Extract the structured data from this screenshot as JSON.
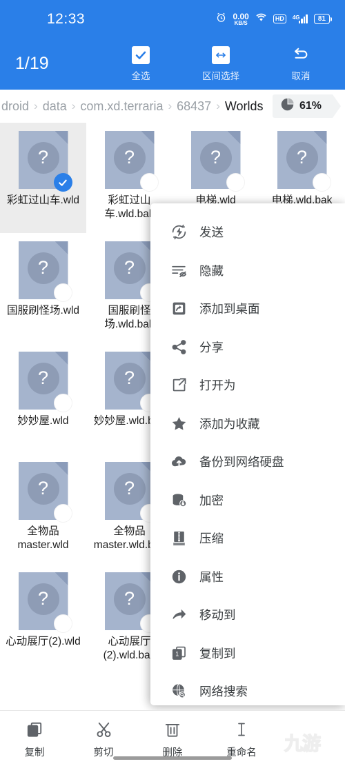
{
  "status_bar": {
    "time": "12:33",
    "alarm_icon": "alarm-icon",
    "net_speed_value": "0.00",
    "net_speed_unit": "KB/S",
    "wifi_icon": "wifi-icon",
    "hd_label": "HD",
    "network_type": "4G",
    "signal_icon": "signal-bars-icon",
    "battery_level": "81"
  },
  "selection_toolbar": {
    "count": "1/19",
    "actions": [
      {
        "label": "全选",
        "icon": "checkbox-checked-icon"
      },
      {
        "label": "区间选择",
        "icon": "arrows-horizontal-icon"
      },
      {
        "label": "取消",
        "icon": "undo-icon"
      }
    ]
  },
  "breadcrumb": {
    "items": [
      "droid",
      "data",
      "com.xd.terraria",
      "68437",
      "Worlds"
    ],
    "separator": "›",
    "storage": {
      "icon": "pie-chart-icon",
      "percent": "61%"
    }
  },
  "files": [
    {
      "name": "彩虹过山车.wld",
      "selected": true,
      "icon": "unknown-file-icon"
    },
    {
      "name": "彩虹过山车.wld.bak",
      "selected": false,
      "icon": "unknown-file-icon"
    },
    {
      "name": "电梯.wld",
      "selected": false,
      "icon": "unknown-file-icon"
    },
    {
      "name": "电梯.wld.bak",
      "selected": false,
      "icon": "unknown-file-icon"
    },
    {
      "name": "国服刷怪场.wld",
      "selected": false,
      "icon": "unknown-file-icon"
    },
    {
      "name": "国服刷怪场.wld.bak",
      "selected": false,
      "icon": "unknown-file-icon"
    },
    {
      "name": "",
      "selected": false,
      "icon": "unknown-file-icon"
    },
    {
      "name": "",
      "selected": false,
      "icon": "unknown-file-icon"
    },
    {
      "name": "妙妙屋.wld",
      "selected": false,
      "icon": "unknown-file-icon"
    },
    {
      "name": "妙妙屋.wld.bak",
      "selected": false,
      "icon": "unknown-file-icon"
    },
    {
      "name": "",
      "selected": false,
      "icon": "unknown-file-icon"
    },
    {
      "name": "",
      "selected": false,
      "icon": "unknown-file-icon"
    },
    {
      "name": "全物品master.wld",
      "selected": false,
      "icon": "unknown-file-icon"
    },
    {
      "name": "全物品master.wld.bak",
      "selected": false,
      "icon": "unknown-file-icon"
    },
    {
      "name": "",
      "selected": false,
      "icon": "unknown-file-icon"
    },
    {
      "name": "",
      "selected": false,
      "icon": "unknown-file-icon"
    },
    {
      "name": "心动展厅(2).wld",
      "selected": false,
      "icon": "unknown-file-icon"
    },
    {
      "name": "心动展厅(2).wld.bak",
      "selected": false,
      "icon": "unknown-file-icon"
    },
    {
      "name": "",
      "selected": false,
      "icon": "unknown-file-icon"
    },
    {
      "name": "",
      "selected": false,
      "icon": "unknown-file-icon"
    }
  ],
  "file_icon_glyph": "?",
  "context_menu": {
    "items": [
      {
        "label": "发送",
        "icon": "send-fast-icon"
      },
      {
        "label": "隐藏",
        "icon": "hide-eye-icon"
      },
      {
        "label": "添加到桌面",
        "icon": "add-to-desktop-icon"
      },
      {
        "label": "分享",
        "icon": "share-icon"
      },
      {
        "label": "打开为",
        "icon": "open-with-icon"
      },
      {
        "label": "添加为收藏",
        "icon": "star-icon"
      },
      {
        "label": "备份到网络硬盘",
        "icon": "cloud-upload-icon"
      },
      {
        "label": "加密",
        "icon": "database-lock-icon"
      },
      {
        "label": "压缩",
        "icon": "compress-zip-icon"
      },
      {
        "label": "属性",
        "icon": "info-icon"
      },
      {
        "label": "移动到",
        "icon": "move-arrow-icon"
      },
      {
        "label": "复制到",
        "icon": "copy-icon"
      },
      {
        "label": "网络搜索",
        "icon": "web-search-icon"
      }
    ]
  },
  "bottom_bar": {
    "items": [
      {
        "label": "复制",
        "icon": "copy-icon"
      },
      {
        "label": "剪切",
        "icon": "scissors-icon"
      },
      {
        "label": "删除",
        "icon": "trash-icon"
      },
      {
        "label": "重命名",
        "icon": "text-cursor-icon"
      }
    ]
  },
  "watermark": {
    "text": "九游"
  },
  "colors": {
    "accent": "#2a7fe8",
    "file_icon": "#a5b4cd",
    "selected_row": "#ececec"
  }
}
